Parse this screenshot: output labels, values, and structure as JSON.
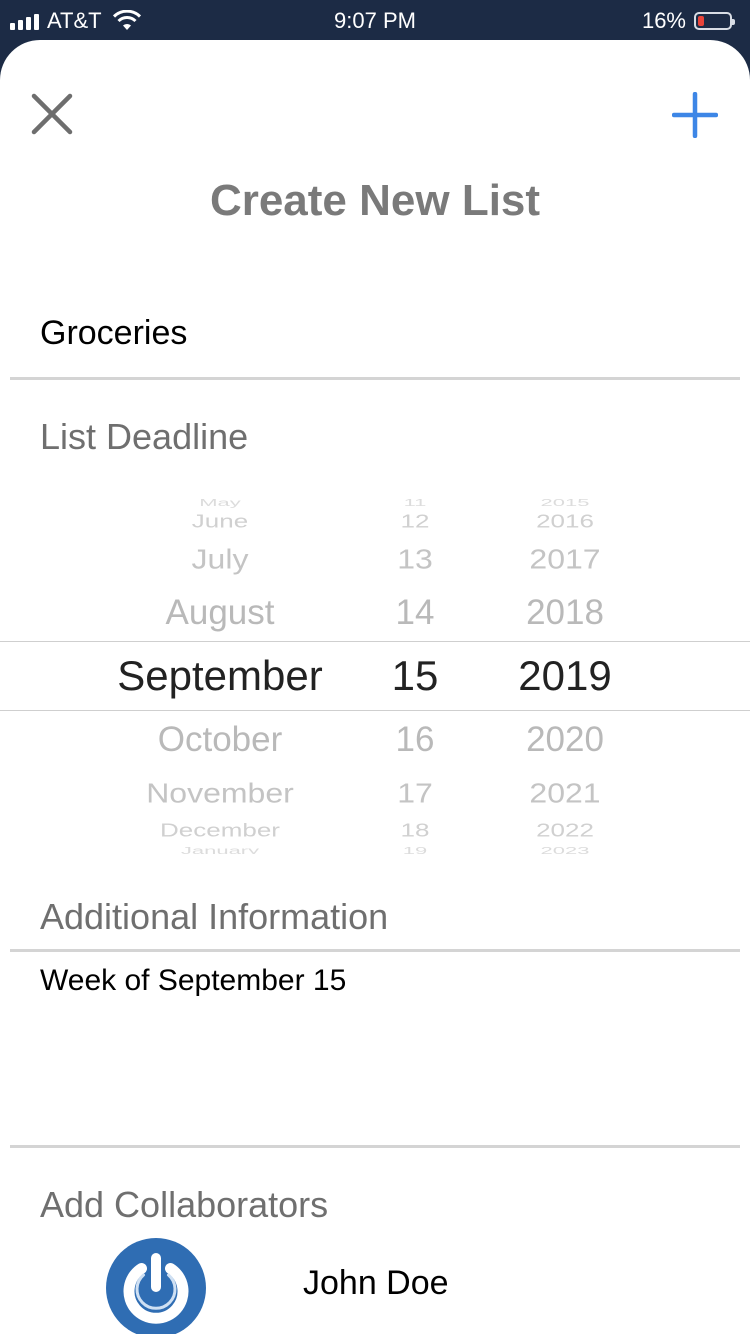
{
  "status_bar": {
    "carrier": "AT&T",
    "time": "9:07 PM",
    "battery_percent": "16%",
    "battery_level": 0.16,
    "signal_icon": "cellular-signal-icon",
    "wifi_icon": "wifi-icon"
  },
  "header": {
    "title": "Create New List",
    "close_icon": "close-icon",
    "add_icon": "plus-icon",
    "accent_color": "#3d86e6"
  },
  "list_name": {
    "value": "Groceries"
  },
  "deadline": {
    "label": "List Deadline",
    "months": [
      "May",
      "June",
      "July",
      "August",
      "September",
      "October",
      "November",
      "December",
      "January"
    ],
    "days": [
      "11",
      "12",
      "13",
      "14",
      "15",
      "16",
      "17",
      "18",
      "19"
    ],
    "years": [
      "2015",
      "2016",
      "2017",
      "2018",
      "2019",
      "2020",
      "2021",
      "2022",
      "2023"
    ],
    "selected": {
      "month": "September",
      "day": "15",
      "year": "2019"
    }
  },
  "additional_info": {
    "label": "Additional Information",
    "value": "Week of September 15"
  },
  "collaborators": {
    "label": "Add Collaborators",
    "items": [
      {
        "name": "John Doe",
        "avatar_icon": "power-button-avatar-icon",
        "avatar_color": "#2f6db3"
      }
    ]
  }
}
